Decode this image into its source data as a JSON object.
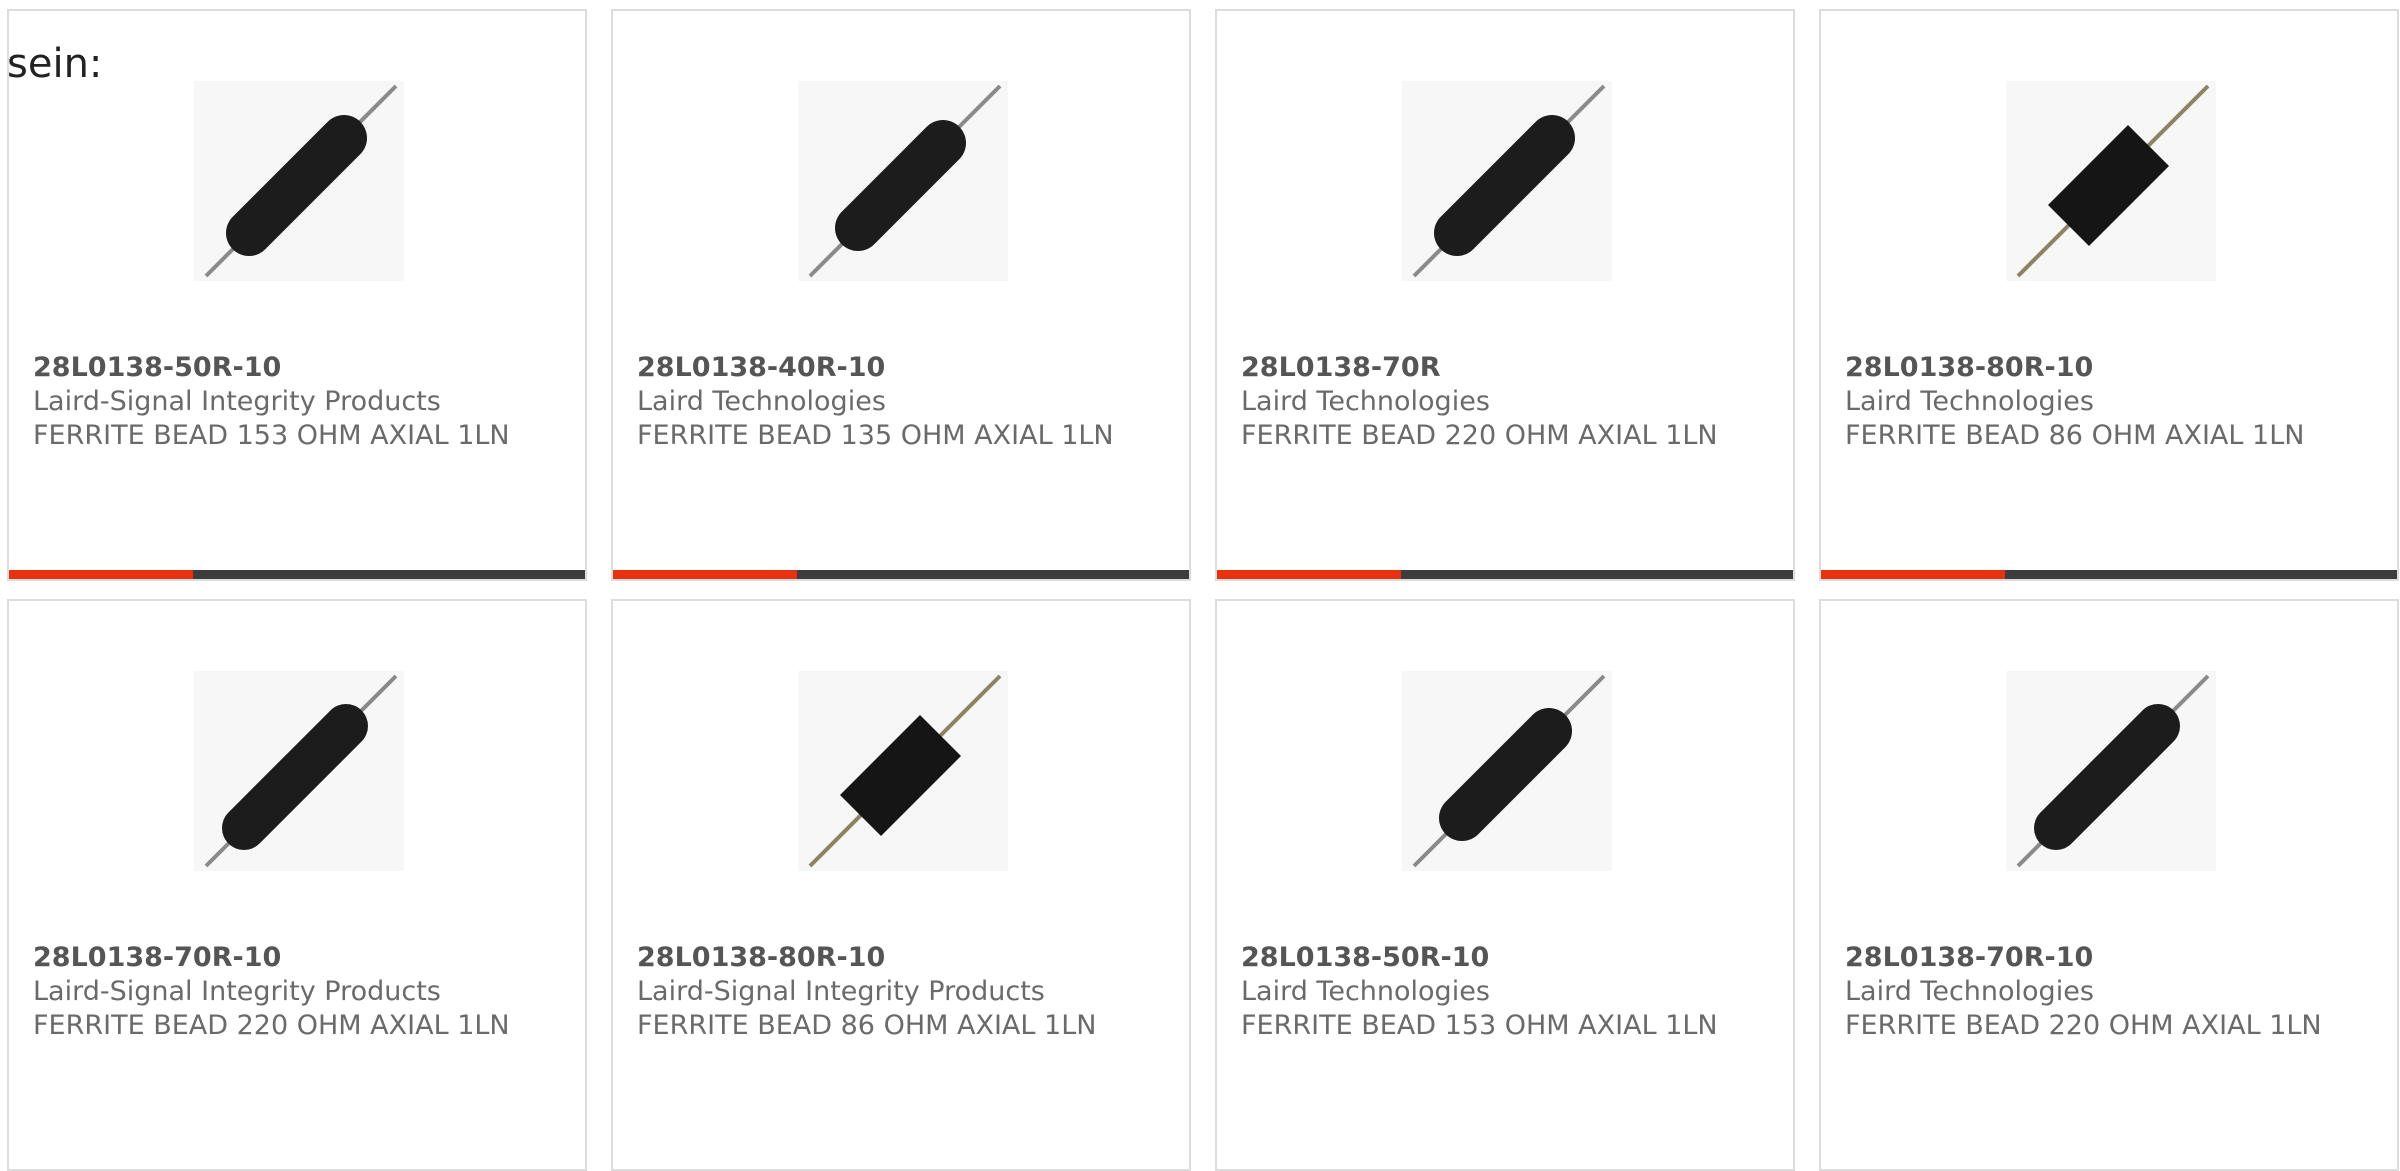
{
  "intro_text": "sein:",
  "colors": {
    "accent": "#e8320f",
    "bar_track": "#3d3d3d",
    "bead_black": "#1a1a1a",
    "lead_silver": "#8a8a8a",
    "lead_olive": "#8a8460"
  },
  "products": [
    {
      "part": "28L0138-50R-10",
      "manufacturer": "Laird-Signal Integrity Products",
      "description": "FERRITE BEAD 153 OHM AXIAL 1LN",
      "icon": "ferrite-bead-long-icon",
      "progress_fraction": 0.32
    },
    {
      "part": "28L0138-40R-10",
      "manufacturer": "Laird Technologies",
      "description": "FERRITE BEAD 135 OHM AXIAL 1LN",
      "icon": "ferrite-bead-long-icon",
      "progress_fraction": 0.32
    },
    {
      "part": "28L0138-70R",
      "manufacturer": "Laird Technologies",
      "description": "FERRITE BEAD 220 OHM AXIAL 1LN",
      "icon": "ferrite-bead-long-icon",
      "progress_fraction": 0.32
    },
    {
      "part": "28L0138-80R-10",
      "manufacturer": "Laird Technologies",
      "description": "FERRITE BEAD 86 OHM AXIAL 1LN",
      "icon": "ferrite-bead-short-icon",
      "progress_fraction": 0.32
    },
    {
      "part": "28L0138-70R-10",
      "manufacturer": "Laird-Signal Integrity Products",
      "description": "FERRITE BEAD 220 OHM AXIAL 1LN",
      "icon": "ferrite-bead-long-icon",
      "progress_fraction": null
    },
    {
      "part": "28L0138-80R-10",
      "manufacturer": "Laird-Signal Integrity Products",
      "description": "FERRITE BEAD 86 OHM AXIAL 1LN",
      "icon": "ferrite-bead-short-icon",
      "progress_fraction": null
    },
    {
      "part": "28L0138-50R-10",
      "manufacturer": "Laird Technologies",
      "description": "FERRITE BEAD 153 OHM AXIAL 1LN",
      "icon": "ferrite-bead-long-icon",
      "progress_fraction": null
    },
    {
      "part": "28L0138-70R-10",
      "manufacturer": "Laird Technologies",
      "description": "FERRITE BEAD 220 OHM AXIAL 1LN",
      "icon": "ferrite-bead-long-icon",
      "progress_fraction": null
    }
  ]
}
